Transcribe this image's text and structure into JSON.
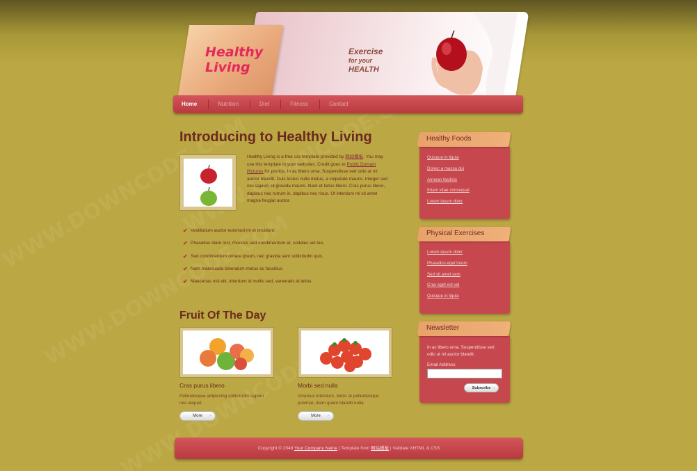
{
  "header": {
    "logo_line1": "Healthy",
    "logo_line2": "Living",
    "tagline_line1": "Exercise",
    "tagline_line2": "for your",
    "tagline_line3": "HEALTH"
  },
  "nav": {
    "items": [
      {
        "label": "Home"
      },
      {
        "label": "Nutrition"
      },
      {
        "label": "Diet"
      },
      {
        "label": "Fitness"
      },
      {
        "label": "Contact"
      }
    ],
    "active": "Home"
  },
  "main": {
    "title": "Introducing to Healthy Living",
    "intro_part1": "Healthy Living is a free css template provided by ",
    "intro_link1": "网站模板",
    "intro_part2": ". You may use this template in your websites. Credit goes to ",
    "intro_link2": "Public Domain Pictures",
    "intro_part3": " for photos. In ac libero urna. Suspendisse sed odio ut mi auctor blandit. Duis luctus nulla metus, a vulputate mauris. Integer sed nisi sapien, ut gravida mauris. Nam et tellus libero. Cras purus libero, dapibus nec rutrum in, dapibus nec risus. Ut interdum mi sit amet magna feugiat auctor.",
    "checklist": [
      "Vestibulum auctor euismod mi et tincidunt.",
      "Phasellus diam orci, rhoncus sed condimentum et, sodales vel leo.",
      "Sed condimentum ornare ipsum, nec gravida sem sollicitudin quis.",
      "Nam malesuada bibendum metus ac faucibus.",
      "Maecenas nisl elit, interdum id mollis sed, venenatis id tellus."
    ],
    "fruit_title": "Fruit Of The Day",
    "fruits": [
      {
        "name": "Cras purus libero",
        "desc": "Pellentesque adipiscing sollicitudin sapien nec aliquet.",
        "button": "More"
      },
      {
        "name": "Morbi sed nulla",
        "desc": "Vivamus interdum, tortor at pellentesque pulvinar, diam quam blandit nulla.",
        "button": "More"
      }
    ]
  },
  "sidebar": {
    "healthy_foods": {
      "title": "Healthy Foods",
      "links": [
        "Quisque in ligula",
        "Donec a massa dui",
        "Aenean facilisis",
        "Etiam vitae consequat",
        "Lorem ipsum dolor"
      ]
    },
    "physical_exercises": {
      "title": "Physical Exercises",
      "links": [
        "Lorem ipsum dolor",
        "Phasellus eget lorem",
        "Sed sit amet sem",
        "Cras eget est vel",
        "Quisque in ligula"
      ]
    },
    "newsletter": {
      "title": "Newsletter",
      "text": "In ac libero urna. Suspendisse sed odio ut mi auctor blandit.",
      "email_label": "Email Address:",
      "button": "Subscribe"
    }
  },
  "footer": {
    "copyright": "Copyright © 2048 ",
    "company_link": "Your Company Name",
    "mid": " | Template from ",
    "template_link": "网站模板",
    "end": " | Validate XHTML & CSS"
  },
  "watermark": "WWW.DOWNCODE.COM",
  "colors": {
    "page_bg": "#bba743",
    "accent_red": "#c6474d",
    "side_head": "#e8a26a",
    "logo_pink": "#e3285a"
  }
}
